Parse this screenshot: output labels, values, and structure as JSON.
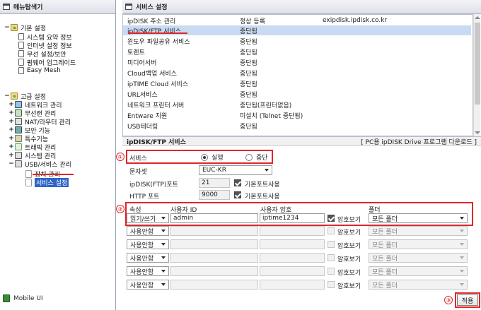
{
  "left_pane": {
    "title": "메뉴탐색기",
    "groups": [
      {
        "label": "기본 설정",
        "items": [
          {
            "label": "시스템 요약 정보",
            "icon": "monitor-icon"
          },
          {
            "label": "인터넷 설정 정보",
            "icon": "monitor-icon"
          },
          {
            "label": "무선 설정/보안",
            "icon": "monitor-icon"
          },
          {
            "label": "펌웨어 업그레이드",
            "icon": "monitor-icon"
          },
          {
            "label": "Easy Mesh",
            "icon": "monitor-icon"
          }
        ]
      },
      {
        "label": "고급 설정",
        "items": [
          {
            "label": "네트워크 관리"
          },
          {
            "label": "무선랜 관리"
          },
          {
            "label": "NAT/라우터 관리"
          },
          {
            "label": "보안 기능"
          },
          {
            "label": "특수기능"
          },
          {
            "label": "트래픽 관리"
          },
          {
            "label": "시스템 관리"
          },
          {
            "label": "USB/서비스 관리"
          }
        ],
        "sub_items": [
          {
            "label": "장치 관리"
          },
          {
            "label": "서비스 설정"
          }
        ]
      }
    ],
    "mobile_ui": "Mobile UI"
  },
  "right_pane": {
    "title": "서비스 설정",
    "service_list": [
      {
        "name": "ipDISK 주소 관리",
        "status": "정상 등록",
        "extra": "exipdisk.ipdisk.co.kr"
      },
      {
        "name": "ipDISK/FTP 서비스",
        "status": "중단됨",
        "extra": ""
      },
      {
        "name": "윈도우 파일공유 서비스",
        "status": "중단됨",
        "extra": ""
      },
      {
        "name": "토렌트",
        "status": "중단됨",
        "extra": ""
      },
      {
        "name": "미디어서버",
        "status": "중단됨",
        "extra": ""
      },
      {
        "name": "Cloud백업 서비스",
        "status": "중단됨",
        "extra": ""
      },
      {
        "name": "ipTIME Cloud 서비스",
        "status": "중단됨",
        "extra": ""
      },
      {
        "name": "URL서비스",
        "status": "중단됨",
        "extra": ""
      },
      {
        "name": "네트워크 프린터 서버",
        "status": "중단됨(프린터없음)",
        "extra": ""
      },
      {
        "name": "Entware 지원",
        "status": "미설치 (Telnet 중단됨)",
        "extra": ""
      },
      {
        "name": "USB테더링",
        "status": "중단됨",
        "extra": ""
      }
    ],
    "section_title": "ipDISK/FTP 서비스",
    "download_link": "[ PC용 ipDISK Drive 프로그램 다운로드 ]",
    "form": {
      "service_label": "서비스",
      "run_label": "실행",
      "stop_label": "중단",
      "charset_label": "문자셋",
      "charset_value": "EUC-KR",
      "ftp_port_label": "ipDISK(FTP)포트",
      "ftp_port_value": "21",
      "http_port_label": "HTTP 포트",
      "http_port_value": "9000",
      "default_port_label": "기본포트사용",
      "col_attr": "속성",
      "col_user": "사용자 ID",
      "col_pass": "사용자 암호",
      "col_folder": "폴더",
      "show_pass_label": "암호보기",
      "rows": [
        {
          "attr": "읽기/쓰기",
          "user": "admin",
          "pass": "iptime1234",
          "folder": "모든 폴더"
        },
        {
          "attr": "사용안함",
          "user": "",
          "pass": "",
          "folder": "모든 폴더"
        },
        {
          "attr": "사용안함",
          "user": "",
          "pass": "",
          "folder": "모든 폴더"
        },
        {
          "attr": "사용안함",
          "user": "",
          "pass": "",
          "folder": "모든 폴더"
        },
        {
          "attr": "사용안함",
          "user": "",
          "pass": "",
          "folder": "모든 폴더"
        },
        {
          "attr": "사용안함",
          "user": "",
          "pass": "",
          "folder": "모든 폴더"
        }
      ]
    },
    "apply_label": "적용"
  },
  "annotations": {
    "m1": "①",
    "m2": "②",
    "m3": "③"
  },
  "colors": {
    "selection": "#c9dbf2",
    "highlight": "#2f64c8",
    "annotation": "#e0262a"
  }
}
